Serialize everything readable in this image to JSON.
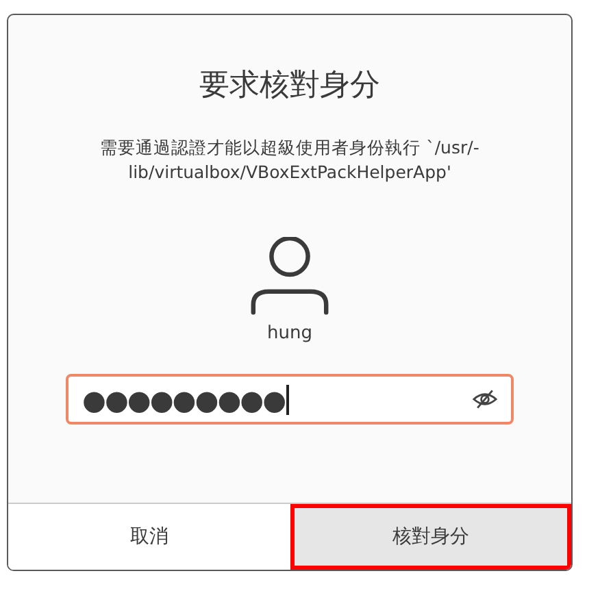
{
  "dialog": {
    "title": "要求核對身分",
    "message": "需要通過認證才能以超級使用者身份執行 `/usr/-\nlib/virtualbox/VBoxExtPackHelperApp'",
    "user": {
      "name": "hung"
    },
    "password": {
      "value": "●●●●●●●●●",
      "focused": true
    },
    "buttons": [
      {
        "label": "取消",
        "highlighted": false
      },
      {
        "label": "核對身分",
        "highlighted": true
      }
    ]
  }
}
